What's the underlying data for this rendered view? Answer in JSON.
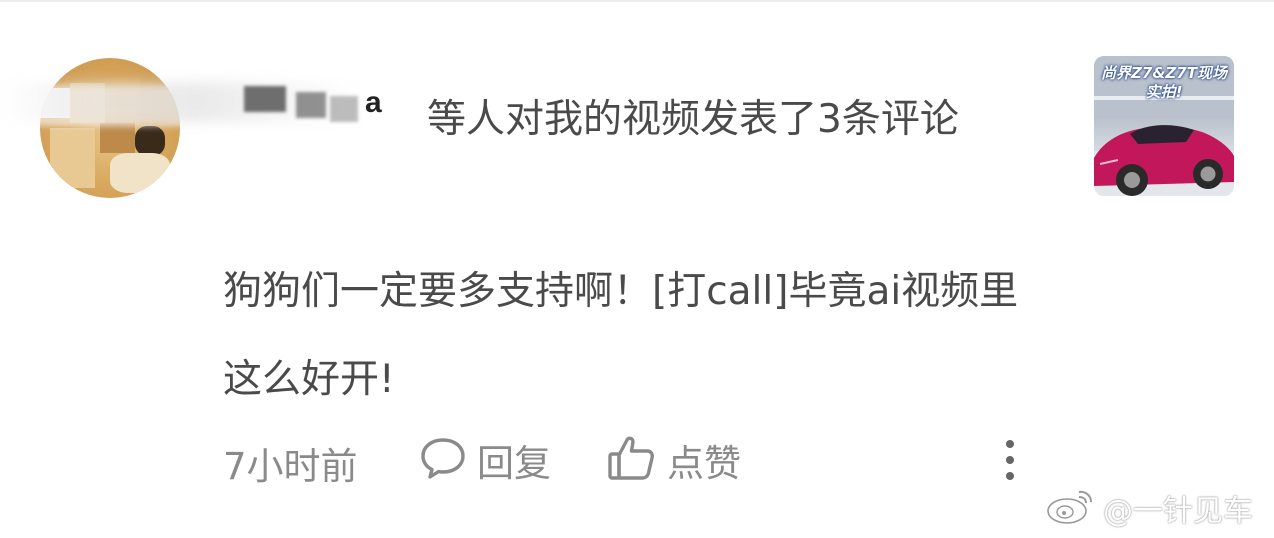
{
  "notification": {
    "username_visible_suffix": "a",
    "message": "等人对我的视频发表了3条评论",
    "comment_text": "狗狗们一定要多支持啊！[打call]毕竟ai视频里这么好开!"
  },
  "actions": {
    "time": "7小时前",
    "reply_label": "回复",
    "like_label": "点赞"
  },
  "thumbnail": {
    "overlay_text": "尚界Z7&Z7T现场实拍!"
  },
  "watermark": {
    "text": "@一针见车"
  },
  "icons": {
    "reply": "comment-bubble-icon",
    "like": "thumbs-up-icon",
    "more": "more-vertical-icon",
    "watermark": "weibo-logo-icon"
  },
  "colors": {
    "text_primary": "#4a4a4a",
    "text_secondary": "#8a8a8a",
    "car": "#c2185b"
  }
}
